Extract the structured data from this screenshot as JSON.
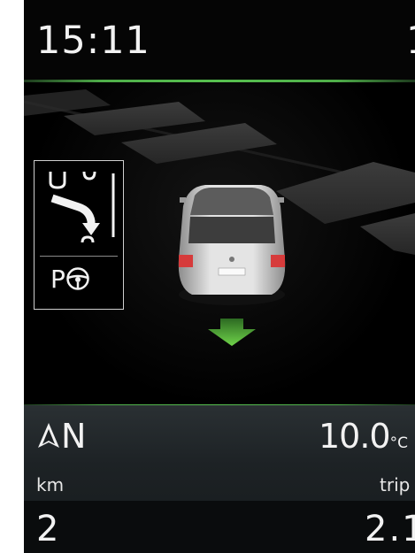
{
  "header": {
    "time": "15:11",
    "right_clip": "1"
  },
  "nav": {
    "direction_letter": "N"
  },
  "status": {
    "temperature_value": "10.0",
    "temperature_unit": "°C",
    "left_unit_label": "km",
    "right_unit_label": "trip",
    "left_value": "2",
    "right_value": "2.1"
  },
  "assist_panel": {
    "park_letter": "P"
  },
  "icons": [
    "navigation-arrow-icon",
    "lane-change-icon",
    "steering-wheel-icon",
    "direction-arrow-icon",
    "car-icon"
  ],
  "colors": {
    "accent_green": "#57c04f",
    "background": "#000000",
    "text": "#f2f2f2"
  }
}
